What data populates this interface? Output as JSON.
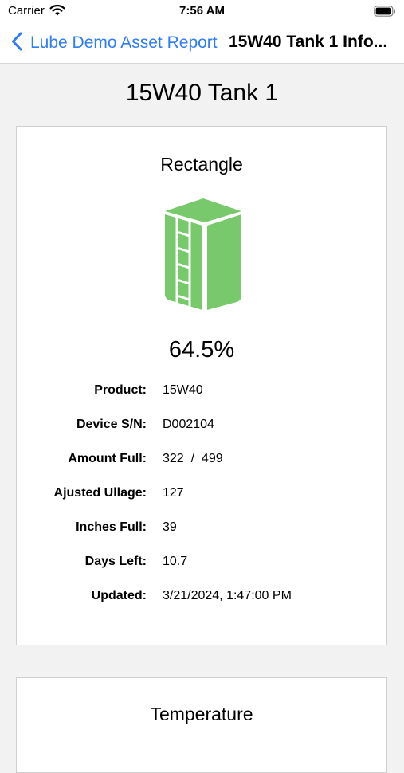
{
  "status_bar": {
    "carrier": "Carrier",
    "time": "7:56 AM"
  },
  "nav": {
    "back_label": "Lube Demo Asset Report",
    "title": "15W40 Tank 1 Info..."
  },
  "page": {
    "title": "15W40 Tank 1"
  },
  "tank_card": {
    "shape": "Rectangle",
    "fill_percent_label": "64.5%",
    "icon": "rectangular-tank-icon",
    "icon_color": "#77c96c",
    "details": [
      {
        "label": "Product:",
        "value": "15W40"
      },
      {
        "label": "Device S/N:",
        "value": "D002104"
      },
      {
        "label": "Amount Full:",
        "value": "322  /  499"
      },
      {
        "label": "Ajusted Ullage:",
        "value": "127"
      },
      {
        "label": "Inches Full:",
        "value": "39"
      },
      {
        "label": "Days Left:",
        "value": "10.7"
      },
      {
        "label": "Updated:",
        "value": "3/21/2024, 1:47:00 PM"
      }
    ]
  },
  "temperature_card": {
    "heading": "Temperature"
  },
  "colors": {
    "accent": "#2f7df6",
    "background": "#f2f2f2",
    "card": "#ffffff",
    "tank_green": "#77c96c"
  }
}
